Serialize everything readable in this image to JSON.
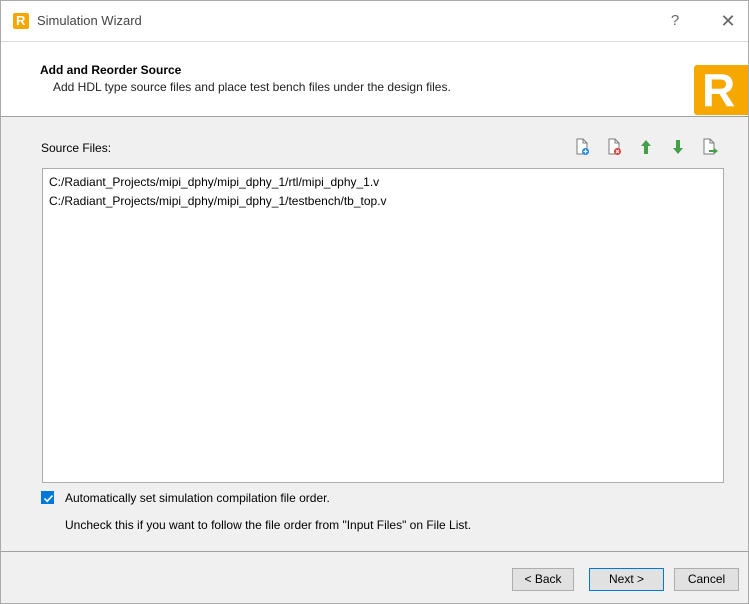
{
  "window": {
    "title": "Simulation Wizard",
    "help_label": "?",
    "close_label": "✕"
  },
  "header": {
    "title": "Add and Reorder Source",
    "subtitle": "Add HDL type source files and place test bench files under the design files.",
    "logo_letter": "R"
  },
  "source": {
    "label": "Source Files:",
    "files": [
      "C:/Radiant_Projects/mipi_dphy/mipi_dphy_1/rtl/mipi_dphy_1.v",
      "C:/Radiant_Projects/mipi_dphy/mipi_dphy_1/testbench/tb_top.v"
    ],
    "toolbar": [
      {
        "name": "add-file-icon",
        "color": "#1e88e5"
      },
      {
        "name": "remove-file-icon",
        "color": "#e53935"
      },
      {
        "name": "move-up-icon",
        "color": "#43a047"
      },
      {
        "name": "move-down-icon",
        "color": "#43a047"
      },
      {
        "name": "export-file-icon",
        "color": "#43a047"
      }
    ]
  },
  "options": {
    "auto_order_label": "Automatically set simulation compilation file order.",
    "auto_order_checked": true,
    "hint": "Uncheck this if you want to follow the file order from \"Input Files\" on File List."
  },
  "buttons": {
    "back": "< Back",
    "next": "Next >",
    "cancel": "Cancel"
  },
  "colors": {
    "accent": "#0078d7",
    "brand": "#f6a800"
  }
}
